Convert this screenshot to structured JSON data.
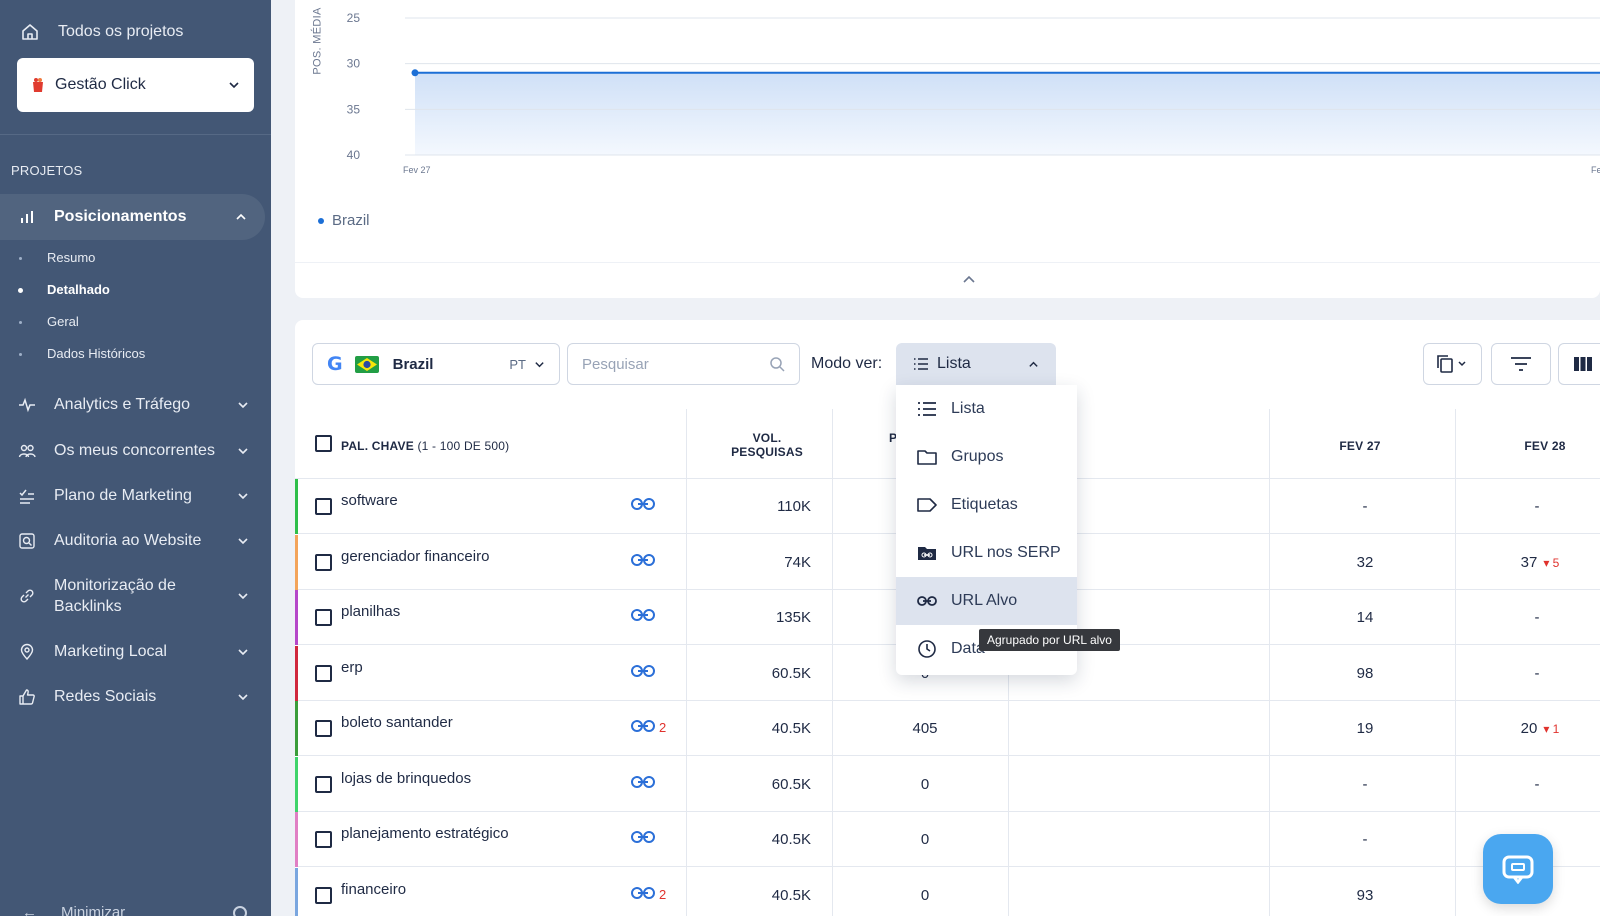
{
  "sidebar": {
    "all_projects": "Todos os projetos",
    "project": "Gestão Click",
    "section": "PROJETOS",
    "active_item": "Posicionamentos",
    "sub_items": [
      "Resumo",
      "Detalhado",
      "Geral",
      "Dados Históricos"
    ],
    "active_sub": "Detalhado",
    "items": [
      {
        "label": "Analytics e Tráfego",
        "icon": "pulse-icon"
      },
      {
        "label": "Os meus concorrentes",
        "icon": "users-icon"
      },
      {
        "label": "Plano de Marketing",
        "icon": "checklist-icon"
      },
      {
        "label": "Auditoria ao Website",
        "icon": "audit-icon"
      },
      {
        "label": "Monitorização de Backlinks",
        "icon": "link-icon"
      },
      {
        "label": "Marketing Local",
        "icon": "location-icon"
      },
      {
        "label": "Redes Sociais",
        "icon": "thumbs-up-icon"
      }
    ],
    "minimize": "Minimizar"
  },
  "chart": {
    "y_title": "POS. MÉDIA",
    "x_first": "Fev 27",
    "x_last": "Fe",
    "legend": "Brazil"
  },
  "chart_data": {
    "type": "area",
    "ylabel": "POS. MÉDIA",
    "y_ticks": [
      25,
      30,
      35,
      40
    ],
    "ylim": [
      25,
      40
    ],
    "y_inverted": true,
    "series": [
      {
        "name": "Brazil",
        "x": [
          "Fev 27",
          "Fe"
        ],
        "values": [
          31,
          31
        ]
      }
    ],
    "grid": true,
    "color": "#1c6fd6"
  },
  "toolbar": {
    "country": "Brazil",
    "lang": "PT",
    "search_placeholder": "Pesquisar",
    "mode_label": "Modo ver:",
    "mode_value": "Lista"
  },
  "dropdown": {
    "items": [
      "Lista",
      "Grupos",
      "Etiquetas",
      "URL nos SERP",
      "URL Alvo",
      "Data"
    ],
    "highlighted": "URL Alvo",
    "tooltip": "Agrupado por URL alvo"
  },
  "table": {
    "col_keyword": "PAL. CHAVE",
    "col_keyword_count": "(1 - 100 DE 500)",
    "col_volume_1": "VOL.",
    "col_volume_2": "PESQUISAS",
    "col_partial": "P",
    "col_fev27": "FEV 27",
    "col_fev28": "FEV 28",
    "rows": [
      {
        "kw": "software",
        "links": "",
        "vol": "110K",
        "p": "",
        "fev27": "-",
        "fev28": "-",
        "delta": "",
        "color": "#2fbf4a"
      },
      {
        "kw": "gerenciador financeiro",
        "links": "",
        "vol": "74K",
        "p": "",
        "fev27": "32",
        "fev28": "37",
        "delta": "▾ 5",
        "color": "#f3a45a"
      },
      {
        "kw": "planilhas",
        "links": "",
        "vol": "135K",
        "p": "",
        "fev27": "14",
        "fev28": "-",
        "delta": "",
        "color": "#b547c9"
      },
      {
        "kw": "erp",
        "links": "",
        "vol": "60.5K",
        "p": "0",
        "fev27": "98",
        "fev28": "-",
        "delta": "",
        "color": "#d0283d"
      },
      {
        "kw": "boleto santander",
        "links": "2",
        "vol": "40.5K",
        "p": "405",
        "fev27": "19",
        "fev28": "20",
        "delta": "▾ 1",
        "color": "#3a9d3a"
      },
      {
        "kw": "lojas de brinquedos",
        "links": "",
        "vol": "60.5K",
        "p": "0",
        "fev27": "-",
        "fev28": "-",
        "delta": "",
        "color": "#3fd46a"
      },
      {
        "kw": "planejamento estratégico",
        "links": "",
        "vol": "40.5K",
        "p": "0",
        "fev27": "-",
        "fev28": "-",
        "delta": "",
        "color": "#e07fc4"
      },
      {
        "kw": "financeiro",
        "links": "2",
        "vol": "40.5K",
        "p": "0",
        "fev27": "93",
        "fev28": "-",
        "delta": "",
        "color": "#7aa6df"
      }
    ]
  }
}
